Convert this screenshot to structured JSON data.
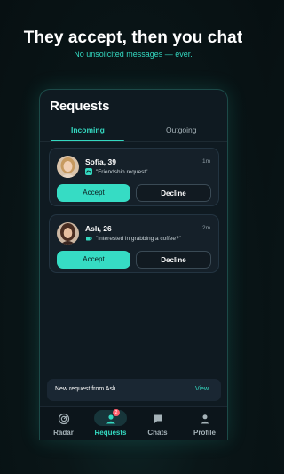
{
  "header": {
    "headline": "They accept, then you chat",
    "subline": "No unsolicited messages — ever."
  },
  "screen": {
    "title": "Requests",
    "tabs": [
      {
        "label": "Incoming",
        "active": true
      },
      {
        "label": "Outgoing",
        "active": false
      }
    ],
    "requests": [
      {
        "name": "Sofia, 39",
        "time": "1m",
        "message": "\"Friendship request\"",
        "message_icon": "handshake-icon",
        "accept_label": "Accept",
        "decline_label": "Decline"
      },
      {
        "name": "Aslı, 26",
        "time": "2m",
        "message": "\"Interested in grabbing a coffee?\"",
        "message_icon": "coffee-icon",
        "accept_label": "Accept",
        "decline_label": "Decline"
      }
    ],
    "toast": {
      "text": "New request from Aslı",
      "action": "View"
    },
    "nav": [
      {
        "label": "Radar",
        "icon": "radar-icon",
        "active": false
      },
      {
        "label": "Requests",
        "icon": "user-icon",
        "active": true,
        "badge": "2"
      },
      {
        "label": "Chats",
        "icon": "chat-bubble-icon",
        "active": false
      },
      {
        "label": "Profile",
        "icon": "profile-icon",
        "active": false
      }
    ]
  },
  "colors": {
    "accent": "#34d8c0",
    "background": "#0a1618",
    "card": "#152029",
    "badge": "#ff5e6c"
  }
}
